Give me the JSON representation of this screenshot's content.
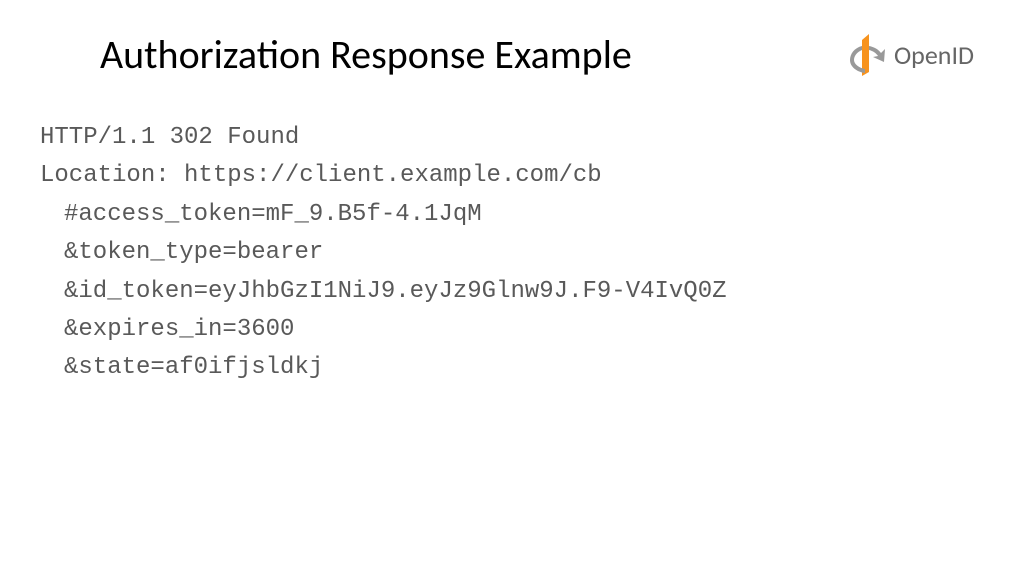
{
  "header": {
    "title": "Authorization Response Example",
    "logo_text": "OpenID"
  },
  "code": {
    "line1": "HTTP/1.1 302 Found",
    "line2": "Location: https://client.example.com/cb",
    "line3": "#access_token=mF_9.B5f-4.1JqM",
    "line4": "&token_type=bearer",
    "line5": "&id_token=eyJhbGzI1NiJ9.eyJz9Glnw9J.F9-V4IvQ0Z",
    "line6": "&expires_in=3600",
    "line7": "&state=af0ifjsldkj"
  }
}
